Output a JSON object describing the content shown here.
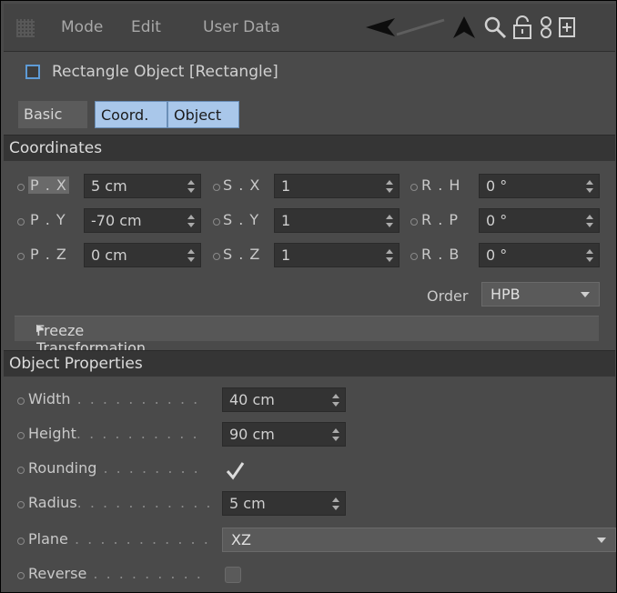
{
  "menu": {
    "items": [
      "Mode",
      "Edit",
      "User Data"
    ],
    "icons": [
      "back-arrow-icon",
      "up-arrow-icon",
      "search-icon",
      "lock-icon",
      "link-icon",
      "new-window-icon"
    ]
  },
  "object": {
    "title": "Rectangle Object [Rectangle]"
  },
  "tabs": [
    {
      "label": "Basic",
      "active": false
    },
    {
      "label": "Coord.",
      "active": true
    },
    {
      "label": "Object",
      "active": true
    }
  ],
  "coordinates": {
    "header": "Coordinates",
    "position": [
      {
        "label": "P . X",
        "value": "5 cm"
      },
      {
        "label": "P . Y",
        "value": "-70 cm"
      },
      {
        "label": "P . Z",
        "value": "0 cm"
      }
    ],
    "scale": [
      {
        "label": "S . X",
        "value": "1"
      },
      {
        "label": "S . Y",
        "value": "1"
      },
      {
        "label": "S . Z",
        "value": "1"
      }
    ],
    "rotation": [
      {
        "label": "R . H",
        "value": "0 °"
      },
      {
        "label": "R . P",
        "value": "0 °"
      },
      {
        "label": "R . B",
        "value": "0 °"
      }
    ],
    "order_label": "Order",
    "order_value": "HPB",
    "freeze": "Freeze Transformation"
  },
  "object_properties": {
    "header": "Object Properties",
    "width": {
      "label": "Width",
      "value": "40 cm"
    },
    "height": {
      "label": "Height",
      "value": "90 cm"
    },
    "rounding": {
      "label": "Rounding",
      "checked": true
    },
    "radius": {
      "label": "Radius",
      "value": "5 cm"
    },
    "plane": {
      "label": "Plane",
      "value": "XZ"
    },
    "reverse": {
      "label": "Reverse",
      "checked": false
    }
  },
  "colors": {
    "accent": "#a9c7ea",
    "checkbox_border": "#5e9bd6",
    "background": "#4a4a4a"
  }
}
